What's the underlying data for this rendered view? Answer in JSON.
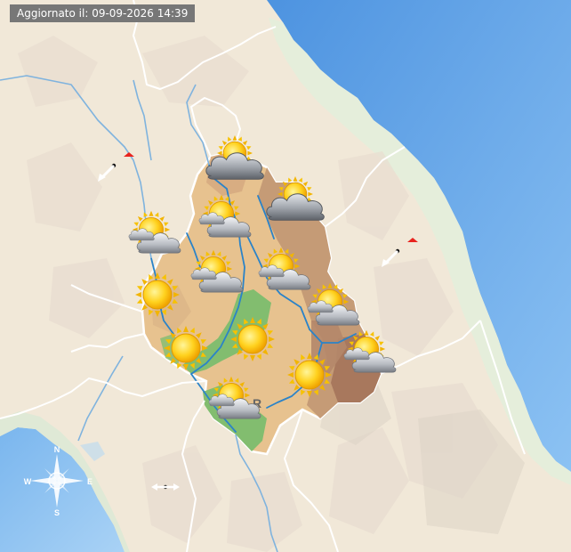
{
  "header": {
    "update_label": "Aggiornato il: 09-09-2026 14:39"
  },
  "map": {
    "sea_color": "#6aaaea",
    "land_color": "#f1e8d8",
    "region_color": "#e6c08f",
    "mountain_color": "#b58b6b",
    "lowland_color": "#7cba6f",
    "river_color": "#2b83c8",
    "border_color": "#ffffff",
    "region_city_initial": "R"
  },
  "compass": {
    "north": "N",
    "south": "S",
    "east": "E",
    "west": "W"
  },
  "forecast_icons": [
    {
      "id": "f1",
      "condition": "cloudy"
    },
    {
      "id": "f2",
      "condition": "cloudy"
    },
    {
      "id": "f3",
      "condition": "partly-cloudy"
    },
    {
      "id": "f4",
      "condition": "partly-cloudy"
    },
    {
      "id": "f5",
      "condition": "partly-cloudy"
    },
    {
      "id": "f6",
      "condition": "partly-cloudy"
    },
    {
      "id": "f7",
      "condition": "sunny"
    },
    {
      "id": "f8",
      "condition": "partly-cloudy"
    },
    {
      "id": "f9",
      "condition": "sunny"
    },
    {
      "id": "f10",
      "condition": "sunny"
    },
    {
      "id": "f11",
      "condition": "partly-cloudy"
    },
    {
      "id": "f12",
      "condition": "sunny"
    },
    {
      "id": "f13",
      "condition": "partly-cloudy"
    },
    {
      "id": "f14",
      "condition": "partly-cloudy"
    }
  ],
  "wind_markers": [
    {
      "id": "w1",
      "icon": "wind-arrow-icon",
      "direction": "south-west",
      "warning": true
    },
    {
      "id": "w2",
      "icon": "wind-arrow-icon",
      "direction": "south-west",
      "warning": true
    },
    {
      "id": "w3",
      "icon": "wind-arrow-icon",
      "direction": "east-west",
      "warning": false
    }
  ]
}
